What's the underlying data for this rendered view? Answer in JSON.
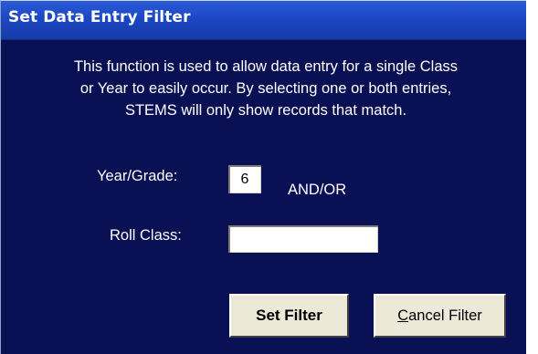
{
  "dialog": {
    "title": "Set Data Entry Filter",
    "description_lines": [
      "This function is used to allow data entry for a single Class",
      "or Year to easily occur.  By selecting one  or both entries,",
      "STEMS will only show records that match."
    ]
  },
  "form": {
    "year_grade": {
      "label": "Year/Grade:",
      "value": "6"
    },
    "connector": "AND/OR",
    "roll_class": {
      "label": "Roll Class:",
      "value": ""
    }
  },
  "buttons": {
    "set_filter": "Set Filter",
    "cancel_filter_accel": "C",
    "cancel_filter_rest": "ancel Filter"
  },
  "colors": {
    "background": "#0a1054",
    "titlebar": "#1d48c4",
    "button_face": "#ece9d8"
  }
}
